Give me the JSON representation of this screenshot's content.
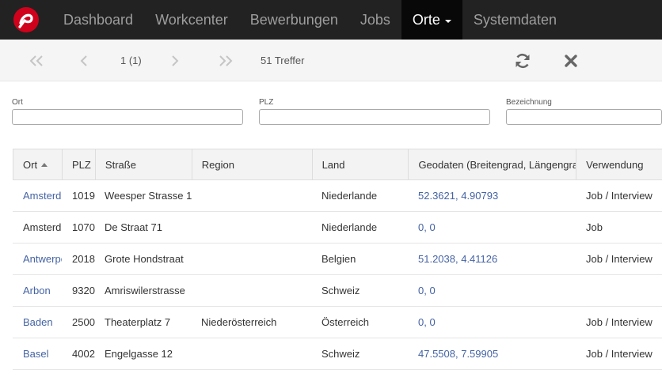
{
  "nav": {
    "items": [
      {
        "label": "Dashboard"
      },
      {
        "label": "Workcenter"
      },
      {
        "label": "Bewerbungen"
      },
      {
        "label": "Jobs"
      },
      {
        "label": "Orte",
        "active": true
      },
      {
        "label": "Systemdaten"
      }
    ]
  },
  "pager": {
    "page": "1 (1)",
    "hits": "51 Treffer"
  },
  "filters": [
    {
      "label": "Ort",
      "value": ""
    },
    {
      "label": "PLZ",
      "value": ""
    },
    {
      "label": "Bezeichnung",
      "value": ""
    }
  ],
  "table": {
    "columns": [
      "Ort",
      "PLZ",
      "Straße",
      "Region",
      "Land",
      "Geodaten (Breitengrad, Längengrad)",
      "Verwendung"
    ],
    "sorted_column": "Ort",
    "sort_direction": "ascending",
    "rows": [
      {
        "ort": "Amsterdam",
        "plz": "1019",
        "strasse": "Weesper Strasse 1",
        "region": "",
        "land": "Niederlande",
        "geo": "52.3621, 4.90793",
        "verwendung": "Job / Interview",
        "ort_link": true
      },
      {
        "ort": "Amsterdam",
        "plz": "1070",
        "strasse": "De Straat 71",
        "region": "",
        "land": "Niederlande",
        "geo": "0, 0",
        "verwendung": "Job",
        "ort_link": false
      },
      {
        "ort": "Antwerpen",
        "plz": "2018",
        "strasse": "Grote Hondstraat",
        "region": "",
        "land": "Belgien",
        "geo": "51.2038, 4.41126",
        "verwendung": "Job / Interview",
        "ort_link": true
      },
      {
        "ort": "Arbon",
        "plz": "9320",
        "strasse": "Amriswilerstrasse",
        "region": "",
        "land": "Schweiz",
        "geo": "0, 0",
        "verwendung": "",
        "ort_link": true
      },
      {
        "ort": "Baden",
        "plz": "2500",
        "strasse": "Theaterplatz 7",
        "region": "Niederösterreich",
        "land": "Österreich",
        "geo": "0, 0",
        "verwendung": "Job / Interview",
        "ort_link": true
      },
      {
        "ort": "Basel",
        "plz": "4002",
        "strasse": "Engelgasse 12",
        "region": "",
        "land": "Schweiz",
        "geo": "47.5508, 7.59905",
        "verwendung": "Job / Interview",
        "ort_link": true
      }
    ]
  },
  "colors": {
    "navbar": "#222222",
    "navbar_active": "#080808",
    "link": "#4563a4",
    "logo": "#d0021b"
  },
  "icons": [
    "logo-icon",
    "first-page-icon",
    "prev-page-icon",
    "next-page-icon",
    "last-page-icon",
    "refresh-icon",
    "close-icon",
    "sort-asc-icon"
  ]
}
